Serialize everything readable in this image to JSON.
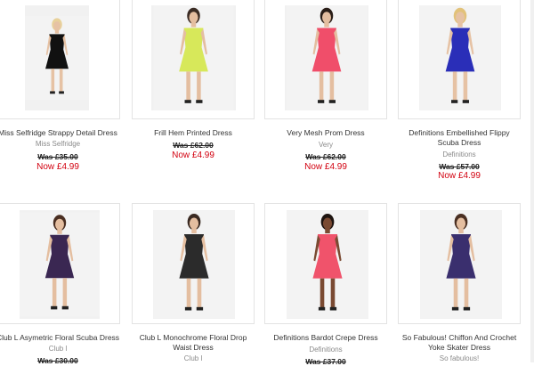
{
  "products": [
    {
      "name": "Miss Selfridge Strappy Detail Dress",
      "brand": "Miss Selfridge",
      "was": "Was £35.00",
      "now": "Now £4.99",
      "dress": "#111111",
      "skin": "#e6c2a4",
      "hair": "#e8d19a",
      "icon": "dress-photo"
    },
    {
      "name": "Frill Hem Printed Dress",
      "brand": "",
      "was": "Was £62.00",
      "now": "Now £4.99",
      "dress": "#d7e85a",
      "skin": "#e4bea0",
      "hair": "#3b2c24",
      "icon": "dress-photo"
    },
    {
      "name": "Very Mesh Prom Dress",
      "brand": "Very",
      "was": "Was £62.00",
      "now": "Now £4.99",
      "dress": "#f04e6a",
      "skin": "#e4bea0",
      "hair": "#2a1e18",
      "icon": "dress-photo"
    },
    {
      "name": "Definitions Embellished Flippy Scuba Dress",
      "brand": "Definitions",
      "was": "Was £57.00",
      "now": "Now £4.99",
      "dress": "#2a2eb8",
      "skin": "#e6c2a4",
      "hair": "#e2c27a",
      "icon": "dress-photo"
    },
    {
      "name": "Club L Asymetric Floral Scuba Dress",
      "brand": "Club l",
      "was": "Was £30.00",
      "now": "",
      "dress": "#3a2752",
      "skin": "#e4bea0",
      "hair": "#4a2f22",
      "icon": "dress-photo"
    },
    {
      "name": "Club L Monochrome Floral Drop Waist Dress",
      "brand": "Club l",
      "was": "",
      "now": "",
      "dress": "#2b2b2b",
      "skin": "#e4bea0",
      "hair": "#3a2a22",
      "icon": "dress-photo"
    },
    {
      "name": "Definitions Bardot Crepe Dress",
      "brand": "Definitions",
      "was": "Was £37.00",
      "now": "",
      "dress": "#f0536b",
      "skin": "#7a4a32",
      "hair": "#1e1410",
      "icon": "dress-photo"
    },
    {
      "name": "So Fabulous! Chiffon And Crochet Yoke Skater Dress",
      "brand": "So fabulous!",
      "was": "",
      "now": "",
      "dress": "#3a2f6e",
      "skin": "#e4bea0",
      "hair": "#4a2f22",
      "icon": "dress-photo"
    }
  ]
}
